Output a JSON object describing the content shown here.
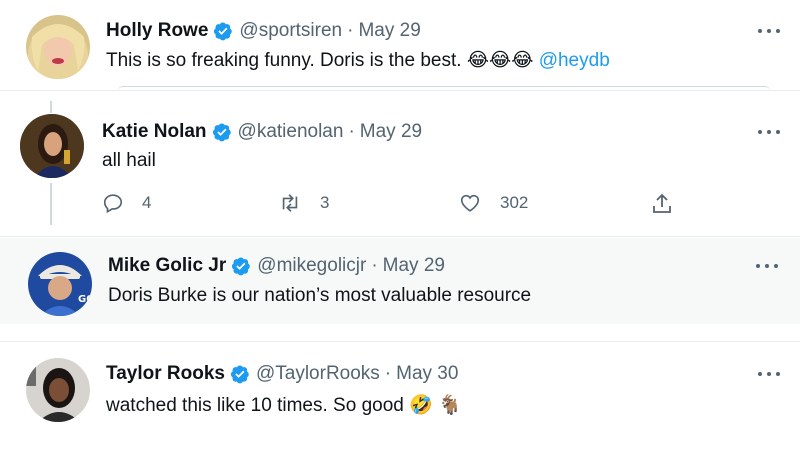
{
  "tweets": [
    {
      "name": "Holly Rowe",
      "handle": "@sportsiren",
      "separator": "·",
      "date": "May 29",
      "text": "This is so freaking funny. Doris is the best.",
      "emojis": [
        "😂",
        "😂",
        "😂"
      ],
      "mention": "@heydb"
    },
    {
      "name": "Katie Nolan",
      "handle": "@katienolan",
      "separator": "·",
      "date": "May 29",
      "text": "all hail",
      "actions": {
        "replies": "4",
        "retweets": "3",
        "likes": "302"
      }
    },
    {
      "name": "Mike Golic Jr",
      "handle": "@mikegolicjr",
      "separator": "·",
      "date": "May 29",
      "text": "Doris Burke is our nation’s most valuable resource"
    },
    {
      "name": "Taylor Rooks",
      "handle": "@TaylorRooks",
      "separator": "·",
      "date": "May 30",
      "text": "watched this like 10 times. So good",
      "emojis": [
        "🤣",
        "🐐"
      ]
    }
  ],
  "colors": {
    "accent": "#1d9bf0",
    "secondary_text": "#536471",
    "highlight_bg": "#f7f9f9"
  },
  "icons": [
    "verified-badge-icon",
    "more-options-icon",
    "reply-icon",
    "retweet-icon",
    "like-icon",
    "share-icon"
  ]
}
